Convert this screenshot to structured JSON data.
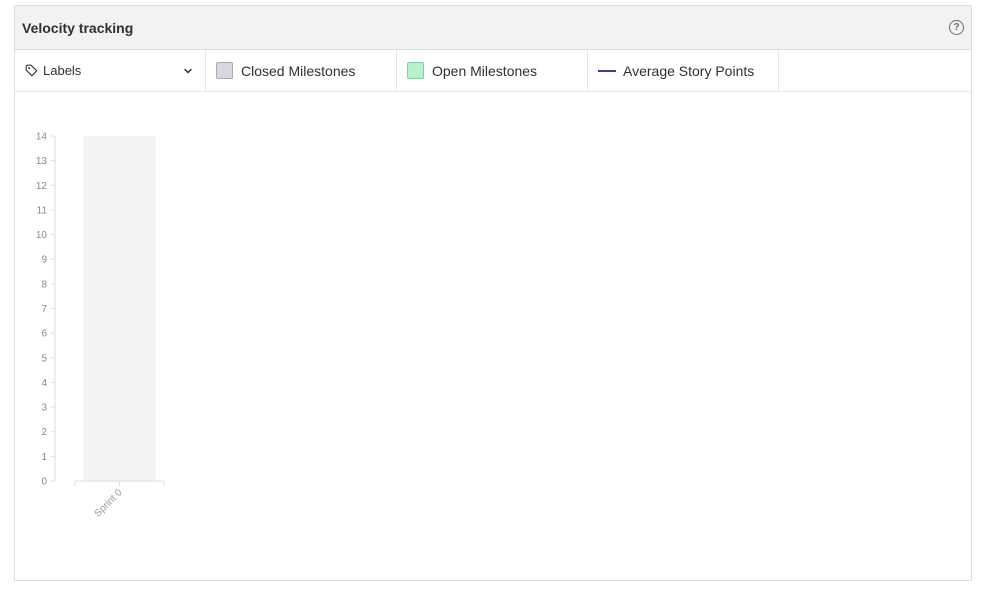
{
  "panel": {
    "title": "Velocity tracking",
    "help_icon": "question-circle-icon"
  },
  "legend": {
    "labels_dropdown": "Labels",
    "items": [
      {
        "label": "Closed Milestones",
        "color": "#d8d8e0"
      },
      {
        "label": "Open Milestones",
        "color": "#b8efcc"
      },
      {
        "label": "Average Story Points",
        "color": "#4b33a8"
      }
    ]
  },
  "chart_data": {
    "type": "bar",
    "categories": [
      "Sprint 0"
    ],
    "values": [
      14
    ],
    "ylim": [
      0,
      14
    ],
    "yticks": [
      0,
      1,
      2,
      3,
      4,
      5,
      6,
      7,
      8,
      9,
      10,
      11,
      12,
      13,
      14
    ],
    "bar_color": "#f3f3f5",
    "grid": false
  }
}
